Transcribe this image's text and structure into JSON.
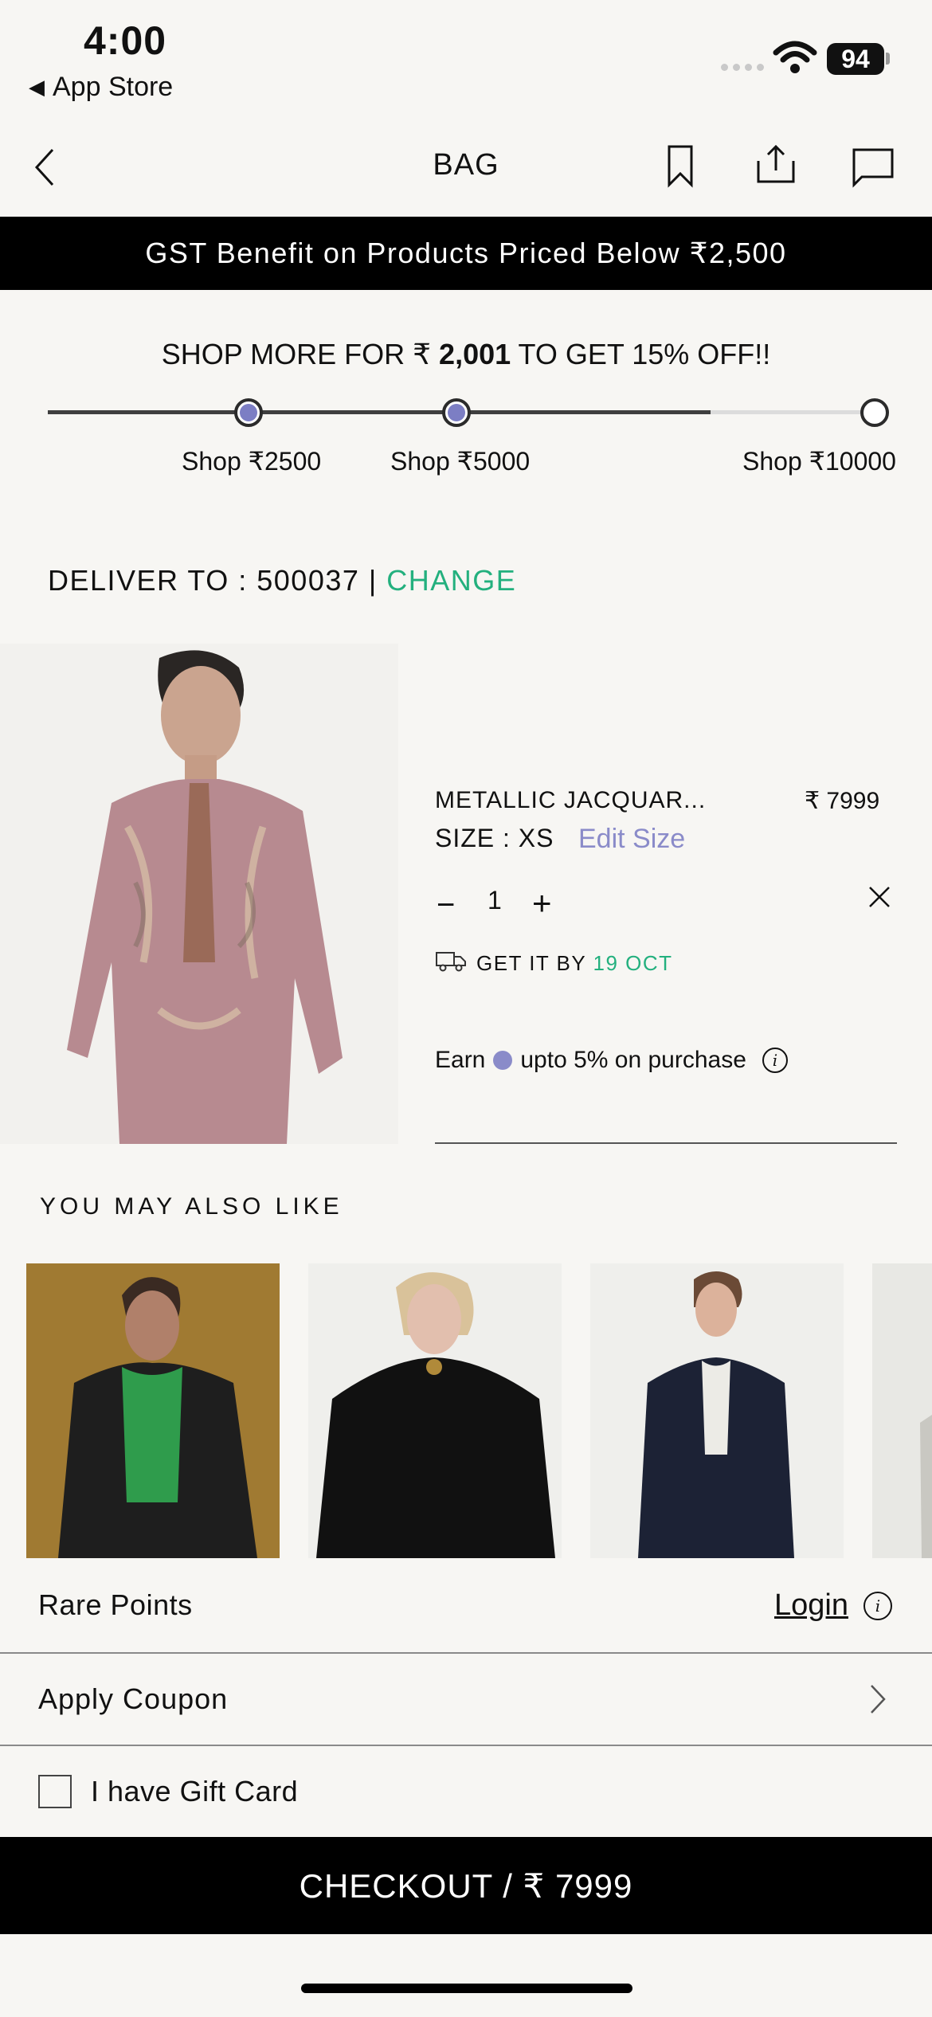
{
  "status_bar": {
    "time": "4:00",
    "back_label": "App Store",
    "battery": "94"
  },
  "nav": {
    "title": "BAG",
    "icons": [
      "back-chevron-icon",
      "bookmark-icon",
      "share-icon",
      "chat-icon"
    ]
  },
  "banner": {
    "text": "GST Benefit on Products Priced Below ₹2,500"
  },
  "offer": {
    "prefix": "SHOP MORE FOR ₹ ",
    "amount": "2,001",
    "suffix": " TO GET 15% OFF!!",
    "progress": 0.8,
    "milestones": [
      {
        "label": "Shop ₹2500",
        "reached": true
      },
      {
        "label": "Shop ₹5000",
        "reached": true
      },
      {
        "label": "Shop ₹10000",
        "reached": false
      }
    ]
  },
  "delivery": {
    "label": "DELIVER TO : 500037",
    "separator": "|",
    "change": "CHANGE"
  },
  "product": {
    "name": "METALLIC JACQUAR...",
    "price": "₹ 7999",
    "size": "SIZE : XS",
    "edit_size": "Edit Size",
    "quantity": "1",
    "qty_minus": "−",
    "qty_plus": "+",
    "delivery_prefix": "GET IT BY ",
    "delivery_date": "19 OCT",
    "earn_prefix": "Earn",
    "earn_suffix": "upto 5% on purchase"
  },
  "recommendations": {
    "title": "YOU MAY ALSO LIKE"
  },
  "rare_points": {
    "label": "Rare Points",
    "login": "Login"
  },
  "coupon": {
    "label": "Apply Coupon"
  },
  "gift_card": {
    "label": "I have Gift Card",
    "checked": false
  },
  "checkout": {
    "label": "CHECKOUT / ₹ 7999"
  },
  "colors": {
    "accent_green": "#23b07e",
    "accent_purple": "#8a8bc9",
    "dark": "#000000"
  }
}
